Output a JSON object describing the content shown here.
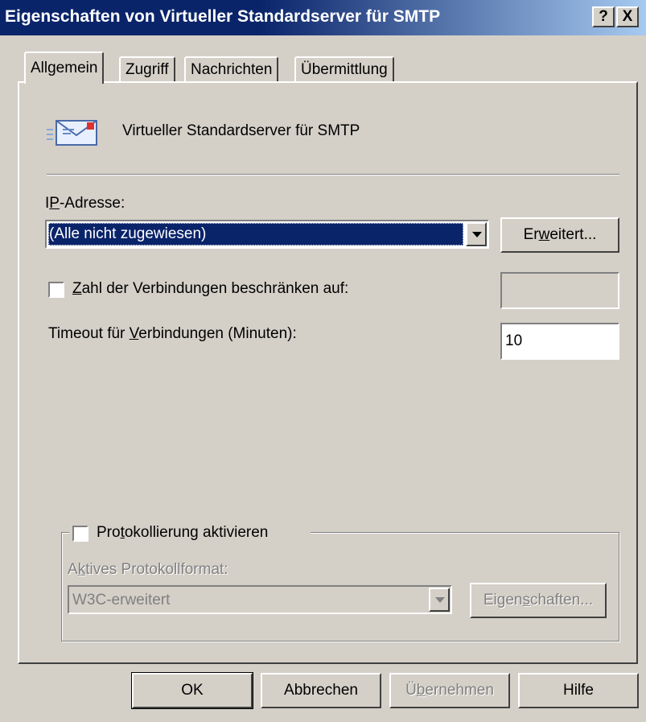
{
  "window": {
    "title": "Eigenschaften von Virtueller Standardserver für SMTP",
    "help_button": "?",
    "close_button": "X"
  },
  "tabs": [
    {
      "label": "Allgemein",
      "active": true
    },
    {
      "label": "Zugriff",
      "active": false
    },
    {
      "label": "Nachrichten",
      "active": false
    },
    {
      "label": "Übermittlung",
      "active": false
    }
  ],
  "general": {
    "server_icon": "mail-envelope-icon",
    "server_name": "Virtueller Standardserver für SMTP",
    "ip_label_mnemonic": "P",
    "ip_label_pre": "I",
    "ip_label_post": "-Adresse:",
    "ip_value": "(Alle nicht zugewiesen)",
    "advanced_pre": "Er",
    "advanced_mnemonic": "w",
    "advanced_post": "eitert...",
    "limit_mnemonic": "Z",
    "limit_post": "ahl der Verbindungen beschränken auf:",
    "limit_checked": false,
    "limit_value": "",
    "timeout_pre": "Timeout für ",
    "timeout_mnemonic": "V",
    "timeout_post": "erbindungen (Minuten):",
    "timeout_value": "10"
  },
  "logging": {
    "enable_pre": "Pro",
    "enable_mnemonic": "t",
    "enable_post": "okollierung aktivieren",
    "enabled": false,
    "format_pre": "A",
    "format_mnemonic": "k",
    "format_post": "tives Protokollformat:",
    "format_value": "W3C-erweitert",
    "properties_pre": "Eigen",
    "properties_mnemonic": "s",
    "properties_post": "chaften..."
  },
  "buttons": {
    "ok": "OK",
    "cancel": "Abbrechen",
    "apply_pre": "Ü",
    "apply_mnemonic": "b",
    "apply_post": "ernehmen",
    "help": "Hilfe"
  },
  "colors": {
    "face": "#d4d0c8",
    "title_active": "#0a246a",
    "selection": "#0a246a"
  }
}
